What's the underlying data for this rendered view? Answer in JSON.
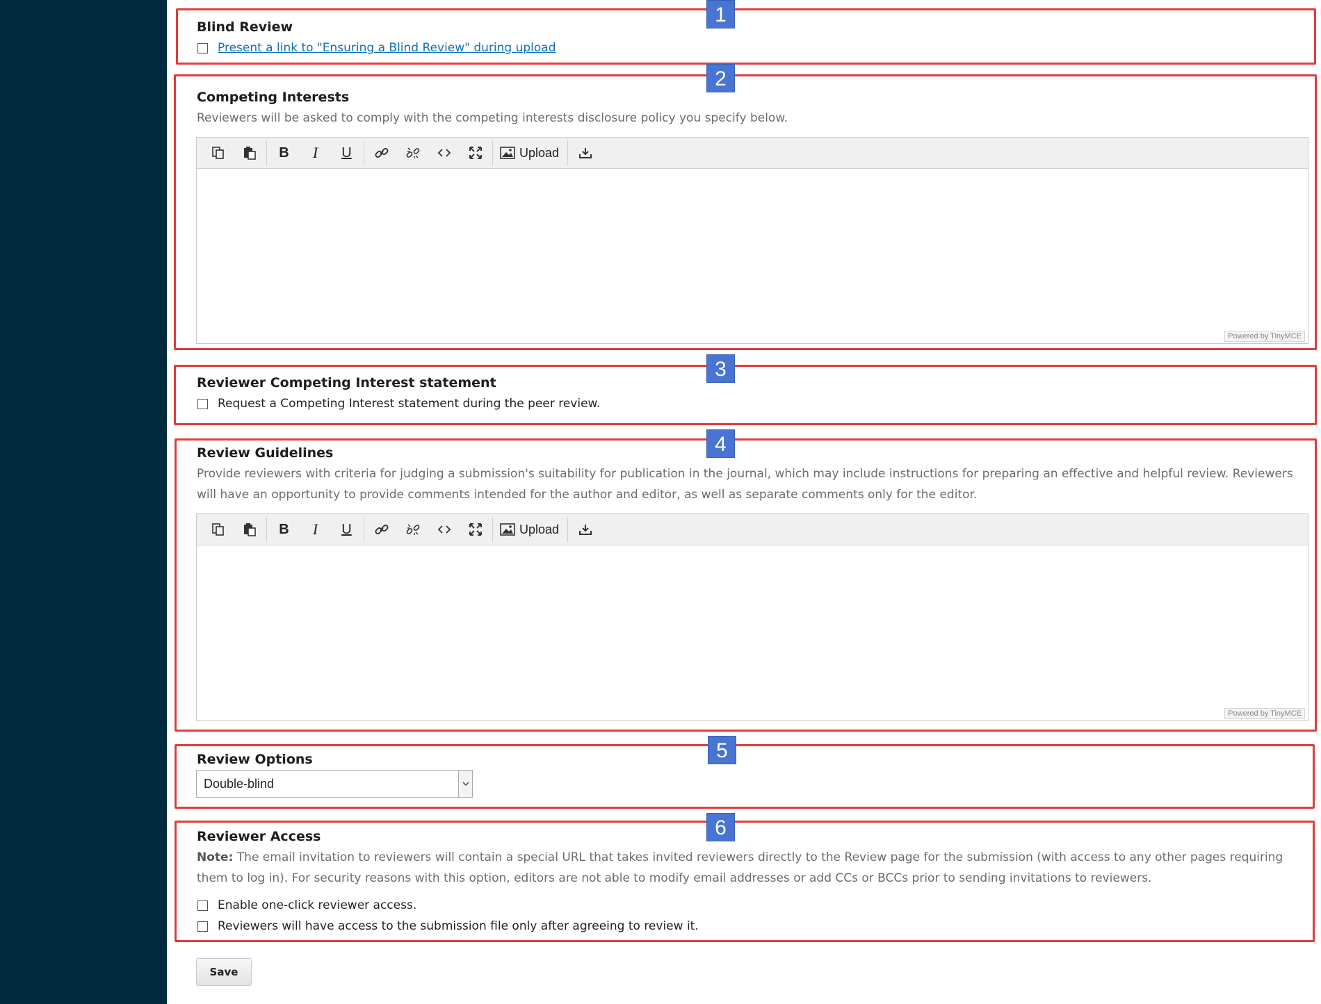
{
  "sections": {
    "blind_review": {
      "badge": "1",
      "title": "Blind Review",
      "checkbox_label": "Present a link to \"Ensuring a Blind Review\" during upload"
    },
    "competing_interests": {
      "badge": "2",
      "title": "Competing Interests",
      "description": "Reviewers will be asked to comply with the competing interests disclosure policy you specify below."
    },
    "reviewer_ci_statement": {
      "badge": "3",
      "title": "Reviewer Competing Interest statement",
      "checkbox_label": "Request a Competing Interest statement during the peer review."
    },
    "review_guidelines": {
      "badge": "4",
      "title": "Review Guidelines",
      "description": "Provide reviewers with criteria for judging a submission's suitability for publication in the journal, which may include instructions for preparing an effective and helpful review. Reviewers will have an opportunity to provide comments intended for the author and editor, as well as separate comments only for the editor."
    },
    "review_options": {
      "badge": "5",
      "title": "Review Options",
      "selected_value": "Double-blind"
    },
    "reviewer_access": {
      "badge": "6",
      "title": "Reviewer Access",
      "note_label": "Note:",
      "note_text": " The email invitation to reviewers will contain a special URL that takes invited reviewers directly to the Review page for the submission (with access to any other pages requiring them to log in). For security reasons with this option, editors are not able to modify email addresses or add CCs or BCCs prior to sending invitations to reviewers.",
      "checkbox_one_click": "Enable one-click reviewer access.",
      "checkbox_after_agree": "Reviewers will have access to the submission file only after agreeing to review it."
    }
  },
  "editor": {
    "upload_label": "Upload",
    "powered_by": "Powered by TinyMCE",
    "bold_glyph": "B",
    "italic_glyph": "I",
    "underline_glyph": "U"
  },
  "save_label": "Save",
  "colors": {
    "sidebar": "#002a3d",
    "highlight_border": "#e23b3b",
    "badge": "#4874d4",
    "link": "#0b73b8"
  }
}
